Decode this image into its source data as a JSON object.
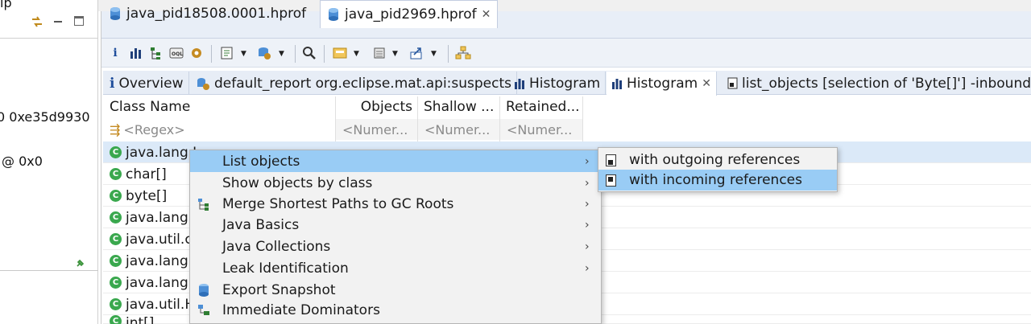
{
  "left_pane": {
    "header_partial": "ip",
    "line1": "0 0xe35d9930",
    "line2": "@ 0x0"
  },
  "editor_tabs": [
    {
      "label": "java_pid18508.0001.hprof",
      "icon": "heap-dump-icon",
      "active": false
    },
    {
      "label": "java_pid2969.hprof",
      "icon": "heap-dump-icon",
      "active": true
    }
  ],
  "inner_tabs": [
    {
      "label": "Overview",
      "icon": "info-icon"
    },
    {
      "label": "default_report  org.eclipse.mat.api:suspects",
      "icon": "report-gear-icon"
    },
    {
      "label": "Histogram",
      "icon": "histogram-icon"
    },
    {
      "label": "Histogram",
      "icon": "histogram-icon",
      "active": true
    },
    {
      "label": "list_objects  [selection of 'Byte[]'] -inbound",
      "icon": "list-objects-icon"
    }
  ],
  "table": {
    "columns": [
      "Class Name",
      "Objects",
      "Shallow ...",
      "Retained..."
    ],
    "filters": [
      "<Regex>",
      "<Numer...",
      "<Numer...",
      "<Numer..."
    ],
    "rows": [
      "java.lang.I",
      "char[]",
      "byte[]",
      "java.lang.S",
      "java.util.cc",
      "java.lang.C",
      "java.lang.C",
      "java.util.H",
      "int[]"
    ]
  },
  "context_menu": {
    "items": [
      {
        "label": "List objects",
        "submenu": true,
        "highlighted": true
      },
      {
        "label": "Show objects by class",
        "submenu": true
      },
      {
        "label": "Merge Shortest Paths to GC Roots",
        "submenu": true,
        "icon": "merge-paths-icon"
      },
      {
        "label": "Java Basics",
        "submenu": true
      },
      {
        "label": "Java Collections",
        "submenu": true
      },
      {
        "label": "Leak Identification",
        "submenu": true
      },
      {
        "label": "Export Snapshot",
        "icon": "export-snapshot-icon"
      },
      {
        "label": "Immediate Dominators",
        "icon": "dominators-icon"
      }
    ]
  },
  "submenu": {
    "items": [
      {
        "label": "with outgoing references"
      },
      {
        "label": "with incoming references",
        "highlighted": true
      }
    ]
  },
  "colors": {
    "highlight": "#99ccf5",
    "tab_bar": "#e8eef7",
    "class_icon": "#3aa84e"
  }
}
